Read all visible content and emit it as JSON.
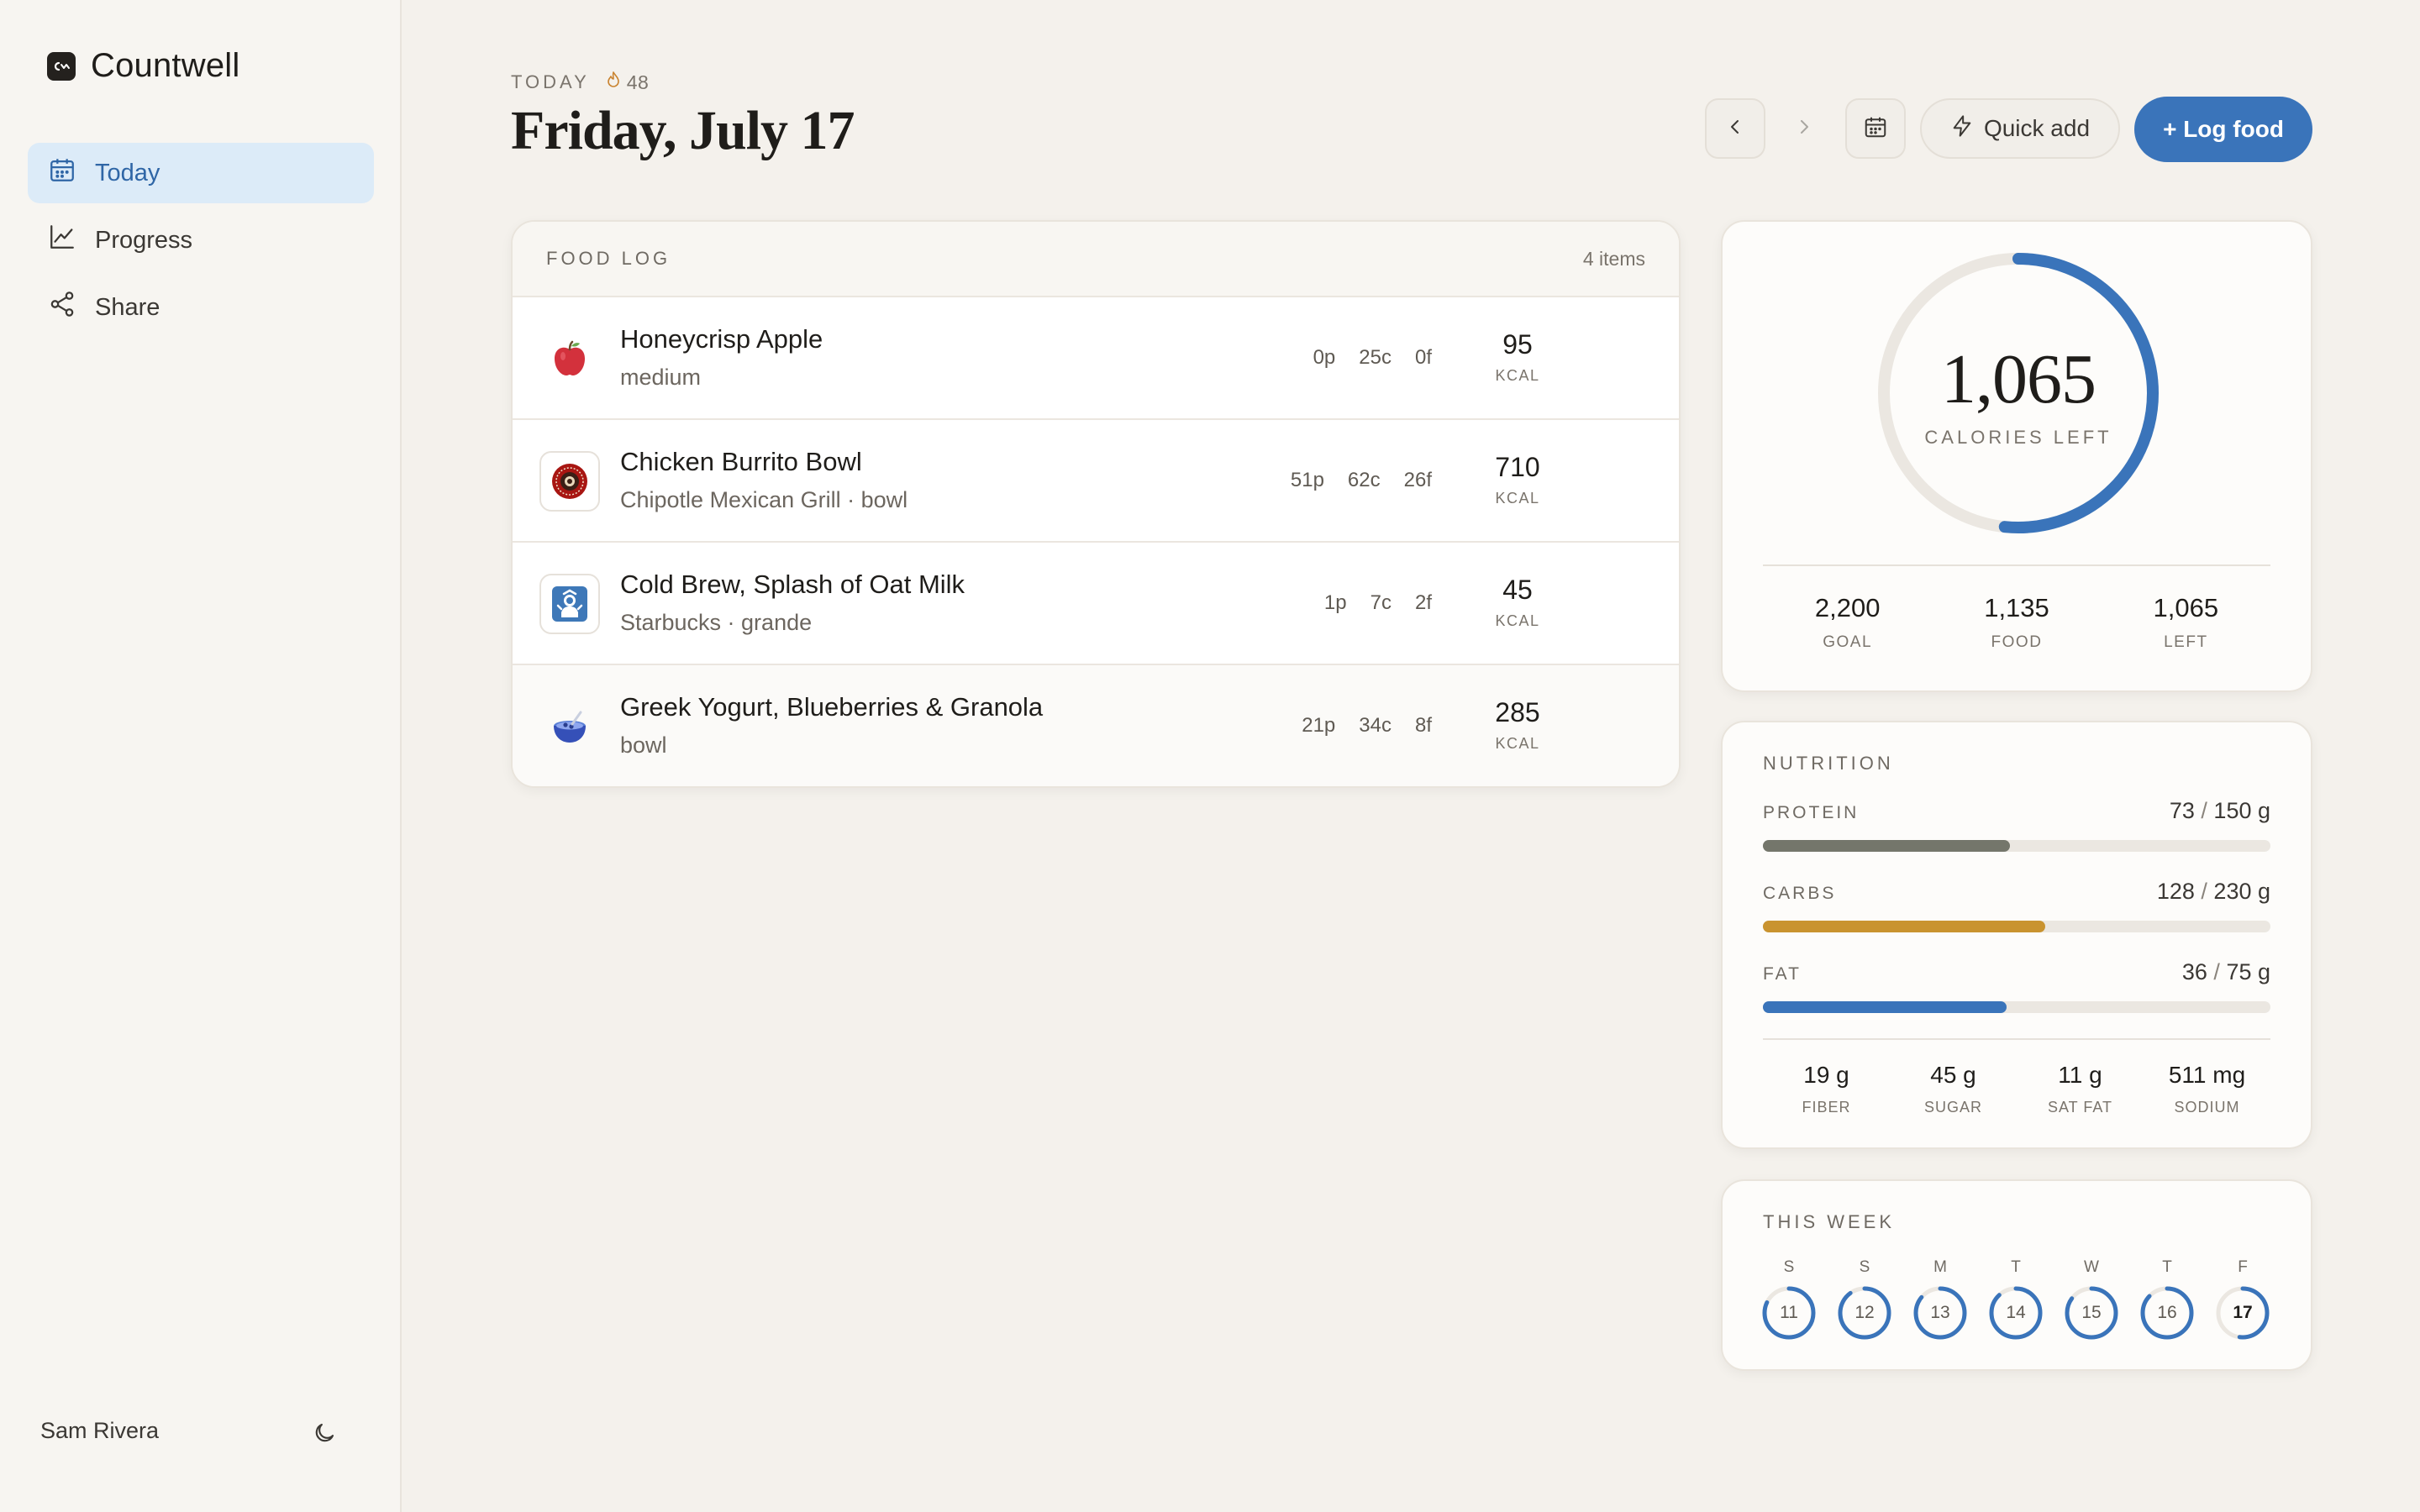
{
  "app": {
    "name": "Countwell"
  },
  "sidebar": {
    "items": [
      {
        "label": "Today",
        "icon": "calendar-icon",
        "active": true
      },
      {
        "label": "Progress",
        "icon": "chart-line-icon",
        "active": false
      },
      {
        "label": "Share",
        "icon": "share-icon",
        "active": false
      }
    ],
    "user_name": "Sam Rivera",
    "theme_icon": "moon-icon"
  },
  "header": {
    "today_label": "TODAY",
    "streak": "48",
    "title": "Friday, July 17",
    "quick_add_label": "Quick add",
    "log_food_label": "+ Log food"
  },
  "food_log": {
    "title": "FOOD LOG",
    "count": "4 items",
    "kcal_label": "KCAL",
    "items": [
      {
        "name": "Honeycrisp Apple",
        "sub": "medium",
        "p": "0p",
        "c": "25c",
        "f": "0f",
        "kcal": "95",
        "icon": "apple-icon"
      },
      {
        "name": "Chicken Burrito Bowl",
        "sub": "Chipotle Mexican Grill · bowl",
        "p": "51p",
        "c": "62c",
        "f": "26f",
        "kcal": "710",
        "icon": "chipotle-logo-icon"
      },
      {
        "name": "Cold Brew, Splash of Oat Milk",
        "sub": "Starbucks · grande",
        "p": "1p",
        "c": "7c",
        "f": "2f",
        "kcal": "45",
        "icon": "starbucks-logo-icon"
      },
      {
        "name": "Greek Yogurt, Blueberries & Granola",
        "sub": "bowl",
        "p": "21p",
        "c": "34c",
        "f": "8f",
        "kcal": "285",
        "icon": "yogurt-bowl-icon"
      }
    ]
  },
  "calories": {
    "left_value": "1,065",
    "left_label": "CALORIES LEFT",
    "progress_fraction": 0.516,
    "stats": [
      {
        "value": "2,200",
        "label": "GOAL"
      },
      {
        "value": "1,135",
        "label": "FOOD"
      },
      {
        "value": "1,065",
        "label": "LEFT"
      }
    ]
  },
  "nutrition": {
    "title": "NUTRITION",
    "macros": [
      {
        "name": "PROTEIN",
        "current": "73",
        "goal": "150 g",
        "fraction": 0.487,
        "color": "#74766b"
      },
      {
        "name": "CARBS",
        "current": "128",
        "goal": "230 g",
        "fraction": 0.557,
        "color": "#c9932f"
      },
      {
        "name": "FAT",
        "current": "36",
        "goal": "75 g",
        "fraction": 0.48,
        "color": "#3a74ba"
      }
    ],
    "stats": [
      {
        "value": "19 g",
        "label": "FIBER"
      },
      {
        "value": "45 g",
        "label": "SUGAR"
      },
      {
        "value": "11 g",
        "label": "SAT FAT"
      },
      {
        "value": "511 mg",
        "label": "SODIUM"
      }
    ]
  },
  "week": {
    "title": "THIS WEEK",
    "days": [
      {
        "letter": "S",
        "date": "11",
        "fraction": 0.82
      },
      {
        "letter": "S",
        "date": "12",
        "fraction": 0.9
      },
      {
        "letter": "M",
        "date": "13",
        "fraction": 0.86
      },
      {
        "letter": "T",
        "date": "14",
        "fraction": 0.88
      },
      {
        "letter": "W",
        "date": "15",
        "fraction": 0.85
      },
      {
        "letter": "T",
        "date": "16",
        "fraction": 0.87
      },
      {
        "letter": "F",
        "date": "17",
        "fraction": 0.52,
        "current": true
      }
    ]
  },
  "colors": {
    "accent": "#3a74ba",
    "active_nav_bg": "#dcebf8",
    "background": "#f4f1ec"
  }
}
